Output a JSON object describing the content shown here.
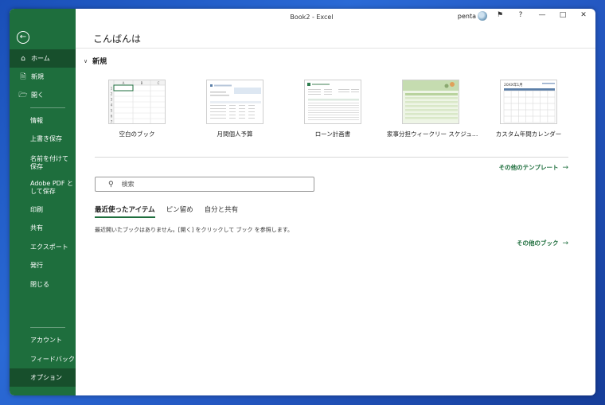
{
  "window": {
    "title": "Book2  -  Excel",
    "user_name": "penta",
    "icons": [
      "feedback-icon",
      "help-icon",
      "minimize-icon",
      "maximize-icon",
      "close-icon"
    ],
    "help_glyph": "?"
  },
  "sidebar": {
    "top_items": [
      {
        "label": "ホーム",
        "icon": "home-icon"
      },
      {
        "label": "新規",
        "icon": "new-file-icon"
      },
      {
        "label": "開く",
        "icon": "open-folder-icon"
      }
    ],
    "items": [
      "情報",
      "上書き保存",
      "名前を付けて保存",
      "Adobe PDF として保存",
      "印刷",
      "共有",
      "エクスポート",
      "発行",
      "閉じる"
    ],
    "bottom_items": [
      "アカウント",
      "フィードバック",
      "オプション"
    ]
  },
  "main": {
    "greeting": "こんばんは",
    "new_section": "新規",
    "templates": [
      {
        "label": "空白のブック"
      },
      {
        "label": "月間個人予算"
      },
      {
        "label": "ローン計画書"
      },
      {
        "label": "家事分担ウィークリー スケジュ…"
      },
      {
        "label": "カスタム年間カレンダー"
      }
    ],
    "more_templates": "その他のテンプレート",
    "search_placeholder": "検索",
    "tabs": [
      "最近使ったアイテム",
      "ピン留め",
      "自分と共有"
    ],
    "empty_message": "最近開いたブックはありません。[開く] をクリックして ブック を参照します。",
    "more_workbooks": "その他のブック",
    "blank_cols": [
      "A",
      "B",
      "C"
    ],
    "blank_rows": [
      "1",
      "2",
      "3",
      "4",
      "5",
      "6",
      "7"
    ],
    "calendar_title": "20XX年1月"
  },
  "colors": {
    "accent": "#1e6e3d",
    "accent_dark": "#174f2c",
    "desktop": "#2458c2"
  }
}
